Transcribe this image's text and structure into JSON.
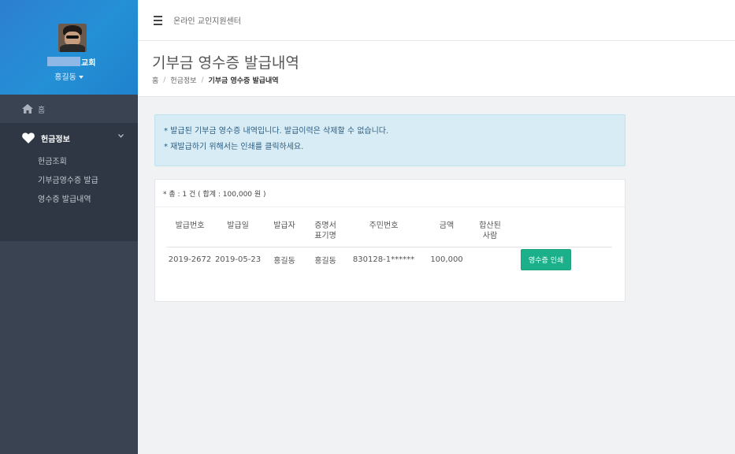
{
  "sidebar": {
    "church_name": "교회",
    "user_name": "홍길동",
    "nav": {
      "home_label": "홈",
      "group_label": "헌금정보",
      "sub_items": [
        "헌금조회",
        "기부금영수증 발급",
        "영수증 발급내역"
      ]
    }
  },
  "topbar": {
    "title": "온라인 교인지원센터"
  },
  "page": {
    "title": "기부금 영수증 발급내역",
    "breadcrumb": [
      "홈",
      "헌금정보",
      "기부금 영수증 발급내역"
    ]
  },
  "alert": {
    "lines": [
      "* 발급된 기부금 영수증 내역입니다. 발급이력은 삭제할 수 없습니다.",
      "* 재발급하기 위해서는 인쇄를 클릭하세요."
    ]
  },
  "summary": "* 총 : 1 건 ( 합계 : 100,000 원 )",
  "table": {
    "headers": [
      "발급번호",
      "발급일",
      "발급자",
      "증명서 표기명",
      "주민번호",
      "금액",
      "합산된 사람"
    ],
    "header_lines": [
      [
        "발급번호"
      ],
      [
        "발급일"
      ],
      [
        "발급자"
      ],
      [
        "증명서",
        "표기명"
      ],
      [
        "주민번호"
      ],
      [
        "금액"
      ],
      [
        "합산된",
        "사람"
      ]
    ],
    "rows": [
      {
        "number": "2019-2672",
        "date": "2019-05-23",
        "issuer": "홍길동",
        "cert_name": "홍길동",
        "resident_no": "830128-1******",
        "amount": "100,000",
        "merged": "",
        "action_label": "영수증 인쇄"
      }
    ]
  },
  "colors": {
    "sidebar_bg": "#3a4352",
    "profile_bg": "#2490d6",
    "button_green": "#1cb08a",
    "alert_bg": "#d8ecf6"
  }
}
